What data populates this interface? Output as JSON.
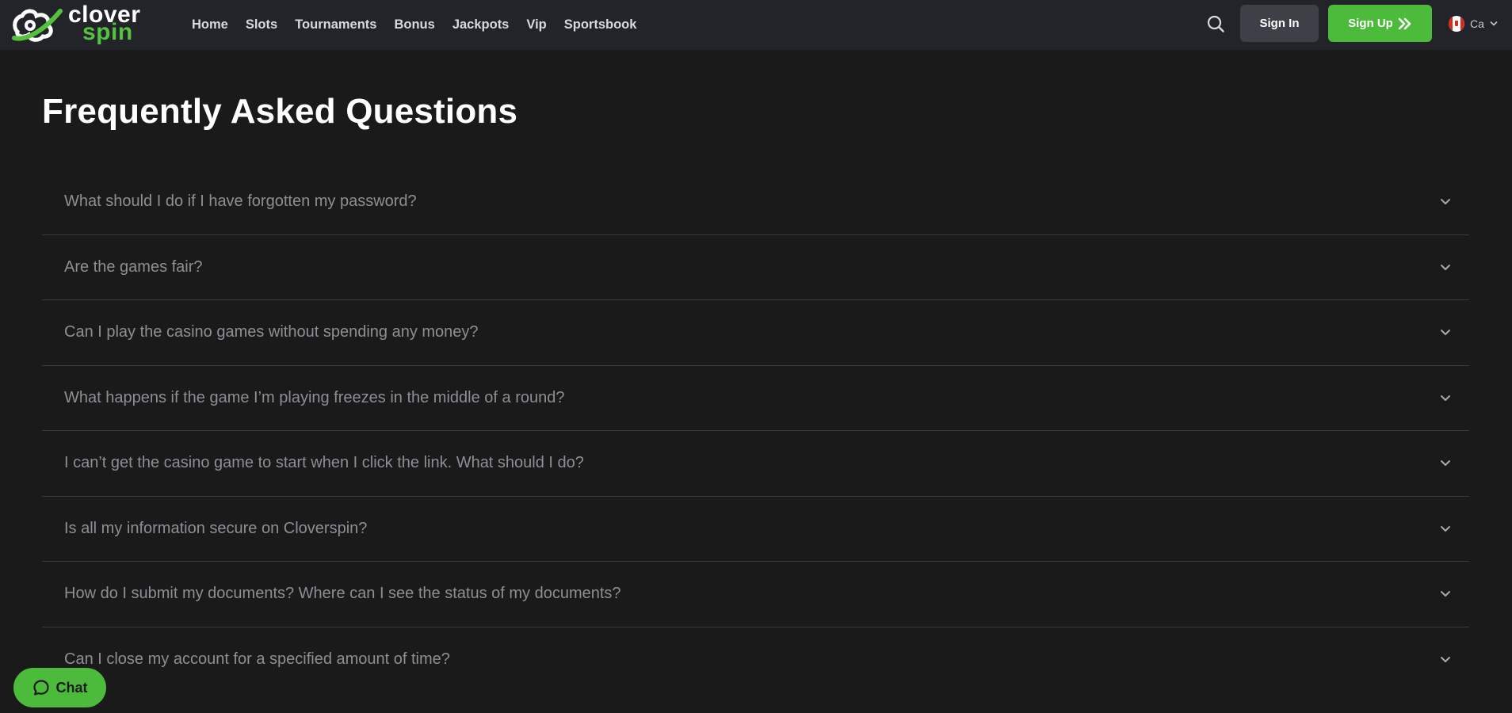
{
  "brand": {
    "name_line1": "clover",
    "name_line2": "spin",
    "accent": "#4cba3b",
    "logo_icon": "clover-logo-icon"
  },
  "nav": {
    "items": [
      {
        "label": "Home"
      },
      {
        "label": "Slots"
      },
      {
        "label": "Tournaments"
      },
      {
        "label": "Bonus"
      },
      {
        "label": "Jackpots"
      },
      {
        "label": "Vip"
      },
      {
        "label": "Sportsbook"
      }
    ]
  },
  "header": {
    "search_icon": "search-icon",
    "signin_label": "Sign In",
    "signup_label": "Sign Up",
    "signup_icon": "double-chevron-right-icon",
    "language": {
      "code": "Ca",
      "flag": "canada-flag-icon",
      "dropdown_icon": "chevron-down-icon"
    }
  },
  "main": {
    "title": "Frequently Asked Questions",
    "faqs": [
      {
        "question": "What should I do if I have forgotten my password?"
      },
      {
        "question": "Are the games fair?"
      },
      {
        "question": "Can I play the casino games without spending any money?"
      },
      {
        "question": "What happens if the game I’m playing freezes in the middle of a round?"
      },
      {
        "question": "I can’t get the casino game to start when I click the link. What should I do?"
      },
      {
        "question": "Is all my information secure on Cloverspin?"
      },
      {
        "question": "How do I submit my documents? Where can I see the status of my documents?"
      },
      {
        "question": "Can I close my account for a specified amount of time?"
      }
    ]
  },
  "chat": {
    "label": "Chat",
    "icon": "chat-bubble-icon"
  },
  "colors": {
    "page_bg": "#1a1a1b",
    "header_bg": "#23242a",
    "signin_bg": "#3f4047",
    "question_text": "#8e8f94"
  }
}
